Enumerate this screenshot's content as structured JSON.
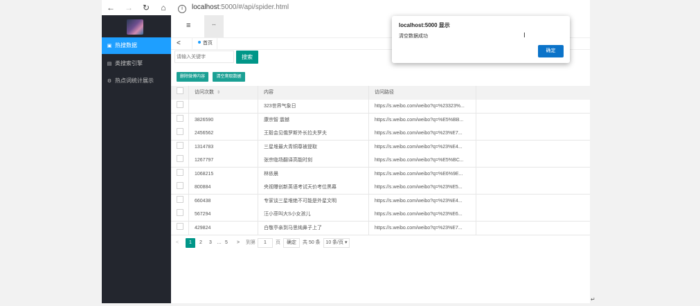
{
  "browser": {
    "back": "←",
    "forward": "→",
    "reload": "↻",
    "home": "⌂",
    "info_icon": "i",
    "url_host": "localhost",
    "url_path": ":5000/#/api/spider.html"
  },
  "sidebar": {
    "items": [
      {
        "icon": "▣",
        "label": "热搜数据",
        "active": true
      },
      {
        "icon": "▤",
        "label": "类搜索引擎",
        "active": false
      },
      {
        "icon": "⚙",
        "label": "热点词统计展示",
        "active": false
      }
    ]
  },
  "topbar": {
    "menu_icon": "≡",
    "refresh_icon": "↔"
  },
  "tabs": {
    "back_arrow": "<",
    "home_label": "首页"
  },
  "search": {
    "placeholder": "请输入关键字",
    "button": "搜索"
  },
  "actions": {
    "btn1": "删除微博内容",
    "btn2": "清空爬取数据"
  },
  "table": {
    "headers": [
      "访问次数",
      "内容",
      "访问路径"
    ],
    "sort_icon": "⇕",
    "rows": [
      {
        "count": "",
        "content": "323世界气象日",
        "url": "https://s.weibo.com/weibo?q=%23323%..."
      },
      {
        "count": "3826590",
        "content": "康宗智 震撼",
        "url": "https://s.weibo.com/weibo?q=%E5%BB..."
      },
      {
        "count": "2456562",
        "content": "王毅会见俄罗斯外长拉夫罗夫",
        "url": "https://s.weibo.com/weibo?q=%23%E7..."
      },
      {
        "count": "1314783",
        "content": "三星堆最大青铜尊被提取",
        "url": "https://s.weibo.com/weibo?q=%23%E4..."
      },
      {
        "count": "1267797",
        "content": "张宗临场翻译高能时刻",
        "url": "https://s.weibo.com/weibo?q=%E5%BC..."
      },
      {
        "count": "1068215",
        "content": "林依晨",
        "url": "https://s.weibo.com/weibo?q=%E6%9E..."
      },
      {
        "count": "800884",
        "content": "央视曝创新英语考试天价考位黑幕",
        "url": "https://s.weibo.com/weibo?q=%23%E5..."
      },
      {
        "count": "660438",
        "content": "专家谈三星堆绝不可能是外星文明",
        "url": "https://s.weibo.com/weibo?q=%23%E4..."
      },
      {
        "count": "567294",
        "content": "汪小菲叫大S小女孩儿",
        "url": "https://s.weibo.com/weibo?q=%23%E6..."
      },
      {
        "count": "429824",
        "content": "白敬亭亲到马思纯鼻子上了",
        "url": "https://s.weibo.com/weibo?q=%23%E7..."
      }
    ]
  },
  "pagination": {
    "prev": "<",
    "p1": "1",
    "p2": "2",
    "p3": "3",
    "ellipsis": "…",
    "p5": "5",
    "next": ">",
    "goto_label": "到第",
    "goto_value": "1",
    "page_label": "页",
    "confirm": "确定",
    "total": "共 50 条",
    "per_page": "10 条/页 ▾"
  },
  "dialog": {
    "title": "localhost:5000 显示",
    "message": "清空数据成功",
    "ok": "确定"
  },
  "corner_mark": "↵"
}
